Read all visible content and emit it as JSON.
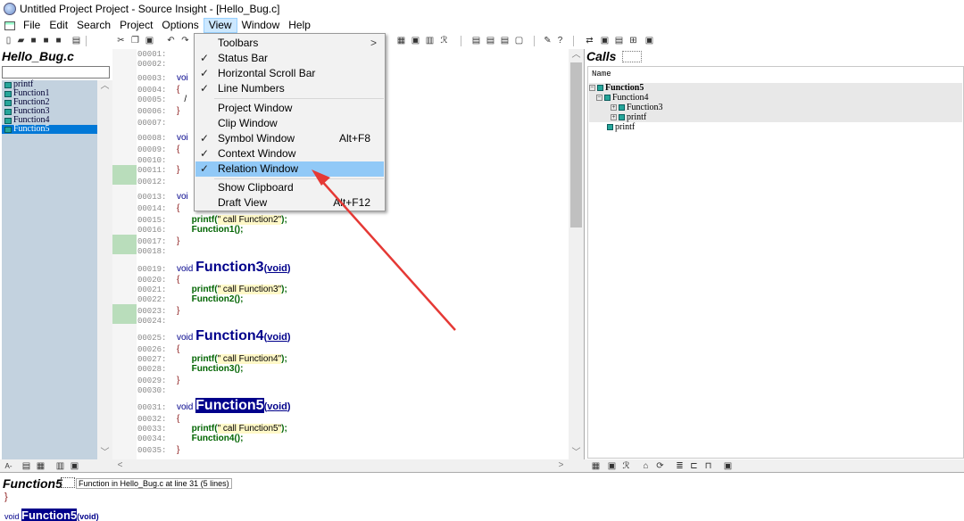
{
  "window": {
    "title": "Untitled Project Project - Source Insight - [Hello_Bug.c]"
  },
  "menubar": {
    "items": [
      "File",
      "Edit",
      "Search",
      "Project",
      "Options",
      "View",
      "Window",
      "Help"
    ]
  },
  "view_menu": {
    "items": [
      {
        "label": "Toolbars",
        "checked": false,
        "submenu": true,
        "shortcut": ""
      },
      {
        "label": "Status Bar",
        "checked": true,
        "shortcut": ""
      },
      {
        "label": "Horizontal Scroll Bar",
        "checked": true,
        "shortcut": ""
      },
      {
        "label": "Line Numbers",
        "checked": true,
        "shortcut": ""
      },
      {
        "label": "Project Window",
        "checked": false,
        "shortcut": ""
      },
      {
        "label": "Clip Window",
        "checked": false,
        "shortcut": ""
      },
      {
        "label": "Symbol Window",
        "checked": true,
        "shortcut": "Alt+F8"
      },
      {
        "label": "Context Window",
        "checked": true,
        "shortcut": ""
      },
      {
        "label": "Relation Window",
        "checked": true,
        "shortcut": "",
        "highlighted": true
      },
      {
        "label": "Show Clipboard",
        "checked": false,
        "shortcut": ""
      },
      {
        "label": "Draft View",
        "checked": false,
        "shortcut": "Alt+F12"
      }
    ],
    "check_glyph": "✓",
    "submenu_glyph": ">"
  },
  "symbol_window": {
    "title": "Hello_Bug.c",
    "filter_value": "",
    "symbols": [
      "printf",
      "Function1",
      "Function2",
      "Function3",
      "Function4",
      "Function5"
    ],
    "selected": "Function5"
  },
  "editor": {
    "lines": {
      "l1": "00001:",
      "l2": "00002:",
      "l3": "00003:",
      "l4": "00004:",
      "l5": "00005:",
      "l6": "00006:",
      "l7": "00007:",
      "l8": "00008:",
      "l9": "00009:",
      "l10": "00010:",
      "l11": "00011:",
      "l12": "00012:",
      "l13": "00013:",
      "l14": "00014:",
      "l15": "00015:",
      "l16": "00016:",
      "l17": "00017:",
      "l18": "00018:",
      "l19": "00019:",
      "l20": "00020:",
      "l21": "00021:",
      "l22": "00022:",
      "l23": "00023:",
      "l24": "00024:",
      "l25": "00025:",
      "l26": "00026:",
      "l27": "00027:",
      "l28": "00028:",
      "l29": "00029:",
      "l30": "00030:",
      "l31": "00031:",
      "l32": "00032:",
      "l33": "00033:",
      "l34": "00034:",
      "l35": "00035:"
    },
    "code": {
      "void": "void",
      "void_partial": "voi",
      "open_brace": "{",
      "close_brace": "}",
      "slash": "/",
      "printf": "printf",
      "str_f2": "\" call Function2\"",
      "str_f3": "\" call Function3\"",
      "str_f4": "\" call Function4\"",
      "str_f5": "\" call Function5\"",
      "call_f1": "Function1",
      "call_f2": "Function2",
      "call_f3": "Function3",
      "call_f4": "Function4",
      "def_f3": "Function3",
      "def_f4": "Function4",
      "def_f5": "Function5",
      "param_void": "void",
      "lparen": "(",
      "rparen": ")",
      "call_args_end": "();",
      "printf_end": ");"
    }
  },
  "relation_window": {
    "title": "Calls",
    "column_header": "Name",
    "tree": [
      {
        "label": "Function5",
        "level": 0,
        "expander": "−",
        "bold": true
      },
      {
        "label": "Function4",
        "level": 1,
        "expander": "−"
      },
      {
        "label": "Function3",
        "level": 2,
        "expander": "+"
      },
      {
        "label": "printf",
        "level": 2,
        "expander": "+"
      },
      {
        "label": "printf",
        "level": 1,
        "expander": ""
      }
    ]
  },
  "context_window": {
    "symbol": "Function5",
    "info": "Function in Hello_Bug.c at line 31 (5 lines)",
    "brace": "}",
    "sig_void": "void",
    "sig_name": "Function5",
    "sig_param": "(void)"
  },
  "colors": {
    "accent_selection": "#0078d7",
    "menu_highlight": "#91c9f7",
    "symbol_list_bg": "#c3d2df",
    "keyword": "#00008b",
    "call": "#006400",
    "annotation_arrow": "#e53935"
  },
  "icons": {
    "app": "source-insight-icon",
    "tree_item": "function-symbol-icon"
  }
}
